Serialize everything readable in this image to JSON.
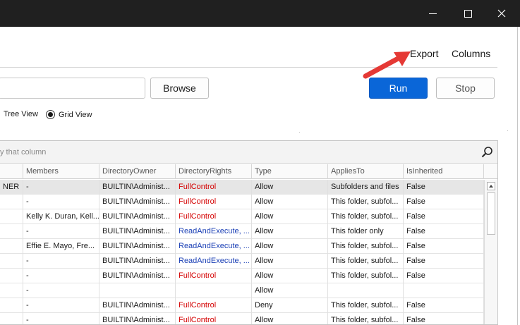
{
  "window": {
    "minimize_icon": "minimize-icon",
    "maximize_icon": "maximize-icon",
    "close_icon": "close-icon"
  },
  "toolbar": {
    "export_label": "Export",
    "columns_label": "Columns"
  },
  "path": {
    "value": "",
    "browse_label": "Browse"
  },
  "actions": {
    "run_label": "Run",
    "stop_label": "Stop"
  },
  "view": {
    "tree_label": "Tree View",
    "grid_label": "Grid View",
    "selected": "Grid View"
  },
  "grid": {
    "group_hint": "y that column",
    "columns": [
      "Members",
      "DirectoryOwner",
      "DirectoryRights",
      "Type",
      "AppliesTo",
      "IsInherited"
    ],
    "rows": [
      {
        "c0": "NER",
        "members": "-",
        "owner": "BUILTIN\\Administ...",
        "rights": "FullControl",
        "rights_color": "red",
        "type": "Allow",
        "applies": "Subfolders and files",
        "inherited": "False",
        "selected": true
      },
      {
        "c0": "",
        "members": "-",
        "owner": "BUILTIN\\Administ...",
        "rights": "FullControl",
        "rights_color": "red",
        "type": "Allow",
        "applies": "This folder, subfol...",
        "inherited": "False"
      },
      {
        "c0": "",
        "members": "Kelly K. Duran, Kell...",
        "owner": "BUILTIN\\Administ...",
        "rights": "FullControl",
        "rights_color": "red",
        "type": "Allow",
        "applies": "This folder, subfol...",
        "inherited": "False"
      },
      {
        "c0": "",
        "members": "-",
        "owner": "BUILTIN\\Administ...",
        "rights": "ReadAndExecute, ...",
        "rights_color": "blue",
        "type": "Allow",
        "applies": "This folder only",
        "inherited": "False"
      },
      {
        "c0": "",
        "members": "Effie E. Mayo, Fre...",
        "owner": "BUILTIN\\Administ...",
        "rights": "ReadAndExecute, ...",
        "rights_color": "blue",
        "type": "Allow",
        "applies": "This folder, subfol...",
        "inherited": "False"
      },
      {
        "c0": "",
        "members": "-",
        "owner": "BUILTIN\\Administ...",
        "rights": "ReadAndExecute, ...",
        "rights_color": "blue",
        "type": "Allow",
        "applies": "This folder, subfol...",
        "inherited": "False"
      },
      {
        "c0": "",
        "members": "-",
        "owner": "BUILTIN\\Administ...",
        "rights": "FullControl",
        "rights_color": "red",
        "type": "Allow",
        "applies": "This folder, subfol...",
        "inherited": "False"
      },
      {
        "c0": "",
        "members": "-",
        "owner": "",
        "rights": "",
        "rights_color": "red",
        "type": "Allow",
        "applies": "",
        "inherited": ""
      },
      {
        "c0": "",
        "members": "-",
        "owner": "BUILTIN\\Administ...",
        "rights": "FullControl",
        "rights_color": "red",
        "type": "Deny",
        "applies": "This folder, subfol...",
        "inherited": "False"
      },
      {
        "c0": "",
        "members": "-",
        "owner": "BUILTIN\\Administ...",
        "rights": "FullControl",
        "rights_color": "red",
        "type": "Allow",
        "applies": "This folder, subfol...",
        "inherited": "False"
      }
    ]
  },
  "colors": {
    "run": "#0a66d8",
    "full_control": "#d40000",
    "read_execute": "#1a3fb5",
    "annotation_arrow": "#e53935"
  }
}
